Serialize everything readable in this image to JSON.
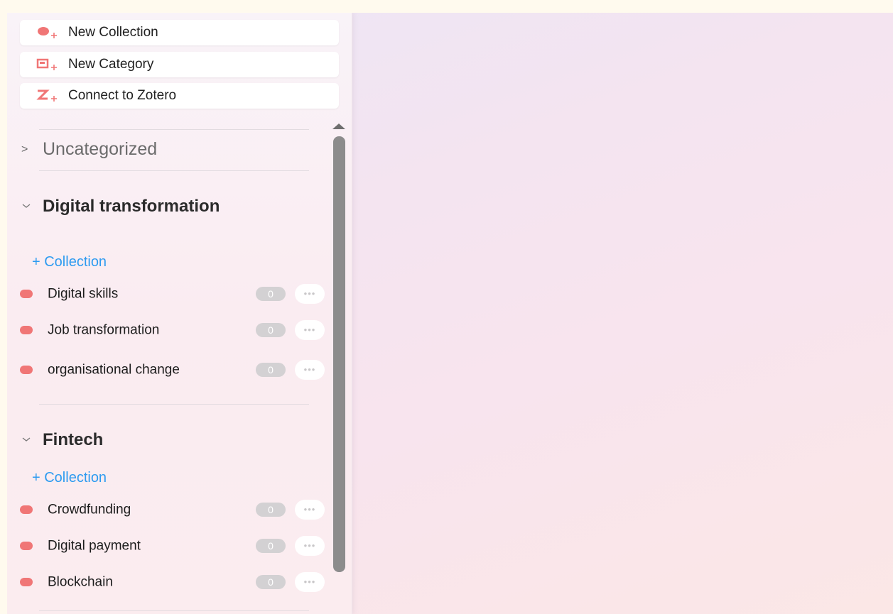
{
  "sidebar": {
    "actions": [
      {
        "label": "New Collection",
        "icon": "new-collection-icon"
      },
      {
        "label": "New Category",
        "icon": "new-category-icon"
      },
      {
        "label": "Connect to Zotero",
        "icon": "zotero-icon"
      }
    ],
    "uncategorized": {
      "chevron": ">",
      "label": "Uncategorized"
    },
    "categories": [
      {
        "title": "Digital transformation",
        "add_label": "+ Collection",
        "items": [
          {
            "name": "Digital skills",
            "count": "0",
            "more": "•••"
          },
          {
            "name": "Job transformation",
            "count": "0",
            "more": "•••"
          },
          {
            "name": "organisational change",
            "count": "0",
            "more": "•••"
          }
        ]
      },
      {
        "title": "Fintech",
        "add_label": "+ Collection",
        "items": [
          {
            "name": "Crowdfunding",
            "count": "0",
            "more": "•••"
          },
          {
            "name": "Digital payment",
            "count": "0",
            "more": "•••"
          },
          {
            "name": "Blockchain",
            "count": "0",
            "more": "•••"
          }
        ]
      }
    ]
  },
  "colors": {
    "accent_icon": "#f07676",
    "link": "#2d9bf0",
    "dot": "#f07676"
  }
}
